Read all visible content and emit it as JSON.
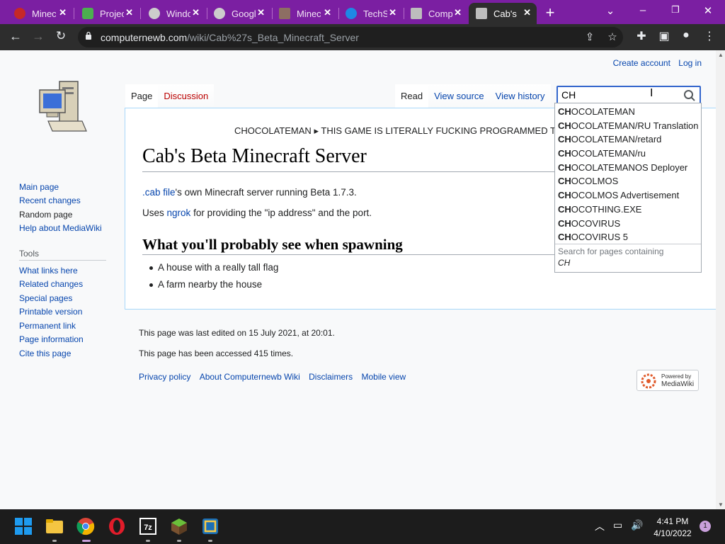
{
  "tabs": [
    {
      "title": "Minecraft"
    },
    {
      "title": "Project"
    },
    {
      "title": "Windows"
    },
    {
      "title": "Google"
    },
    {
      "title": "Minecraft"
    },
    {
      "title": "TechS"
    },
    {
      "title": "Comp"
    },
    {
      "title": "Cab's"
    }
  ],
  "toolbar": {
    "url_host": "computernewb.com",
    "url_path": "/wiki/Cab%27s_Beta_Minecraft_Server"
  },
  "wiki": {
    "create_account": "Create account",
    "log_in": "Log in",
    "tab_page": "Page",
    "tab_discussion": "Discussion",
    "tab_read": "Read",
    "tab_view_source": "View source",
    "tab_view_history": "View history",
    "notice_left": "CHOCOLATEMAN",
    "notice_right": "THIS GAME IS LITERALLY FUCKING PROGRAMMED TO",
    "title": "Cab's Beta Minecraft Server",
    "p1_link": ".cab file",
    "p1_text": "'s own Minecraft server running Beta 1.7.3.",
    "p2_pre": "Uses",
    "p2_link": "ngrok",
    "p2_post": "for providing the \"ip address\" and the port.",
    "h2": "What you'll probably see when spawning",
    "list": [
      "A house with a really tall flag",
      "A farm nearby the house"
    ]
  },
  "sidebar": {
    "nav": [
      "Main page",
      "Recent changes",
      "Random page",
      "Help about MediaWiki"
    ],
    "tools_heading": "Tools",
    "tools": [
      "What links here",
      "Related changes",
      "Special pages",
      "Printable version",
      "Permanent link",
      "Page information",
      "Cite this page"
    ]
  },
  "footer": {
    "last_edited": "This page was last edited on 15 July 2021, at 20:01.",
    "accessed": "This page has been accessed 415 times.",
    "links": [
      "Privacy policy",
      "About Computernewb Wiki",
      "Disclaimers",
      "Mobile view"
    ],
    "powered_line1": "Powered by",
    "powered_line2": "MediaWiki"
  },
  "search": {
    "value": "CH",
    "query": "CH",
    "suggestions": [
      "OCOLATEMAN",
      "OCOLATEMAN/RU Translation",
      "OCOLATEMAN/retard",
      "OCOLATEMAN/ru",
      "OCOLATEMANOS Deployer",
      "OCOLMOS",
      "OCOLMOS Advertisement",
      "OCOTHING.EXE",
      "OCOVIRUS",
      "OCOVIRUS 5"
    ],
    "containing_label": "Search for pages containing"
  },
  "taskbar": {
    "time": "4:41 PM",
    "date": "4/10/2022",
    "notification_count": "1"
  },
  "colors": {
    "tab_strip": "#7b1fa2",
    "link": "#0645ad",
    "new_link": "#ba0000",
    "search_border": "#36c"
  }
}
